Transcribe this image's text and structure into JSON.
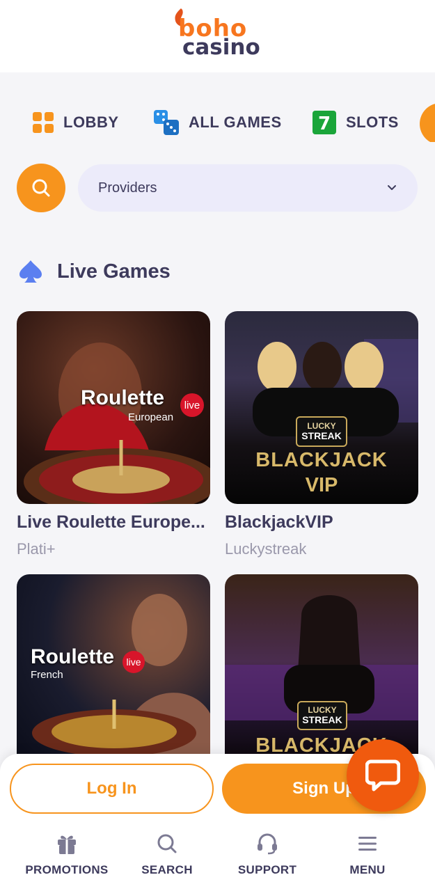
{
  "header": {
    "logo_top": "boho",
    "logo_bottom": "casino"
  },
  "nav": {
    "items": [
      {
        "label": "LOBBY",
        "icon": "lobby-grid-icon"
      },
      {
        "label": "ALL GAMES",
        "icon": "dice-icon"
      },
      {
        "label": "SLOTS",
        "icon": "slots-seven-icon"
      }
    ]
  },
  "filters": {
    "search_icon": "search-icon",
    "providers_label": "Providers"
  },
  "section": {
    "title": "Live Games",
    "icon": "spade-icon"
  },
  "games": [
    {
      "title": "Live Roulette Europe...",
      "provider": "Plati+",
      "art_title": "Roulette",
      "art_sub": "European",
      "art_badge": "live"
    },
    {
      "title": "BlackjackVIP",
      "provider": "Luckystreak",
      "art_badge_top": "LUCKY",
      "art_badge_bottom": "STREAK",
      "art_title": "BLACKJACK",
      "art_sub": "VIP"
    },
    {
      "art_title": "Roulette",
      "art_sub": "French",
      "art_badge": "live"
    },
    {
      "art_badge_top": "LUCKY",
      "art_badge_bottom": "STREAK",
      "art_title": "BLACKJACK"
    }
  ],
  "actions": {
    "login": "Log In",
    "signup": "Sign Up"
  },
  "tabbar": [
    {
      "label": "PROMOTIONS",
      "icon": "gift-icon"
    },
    {
      "label": "SEARCH",
      "icon": "search-icon"
    },
    {
      "label": "SUPPORT",
      "icon": "headset-icon"
    },
    {
      "label": "MENU",
      "icon": "hamburger-icon"
    }
  ],
  "colors": {
    "accent": "#f7941d",
    "chat": "#f05a0e",
    "text": "#3d3a5c",
    "muted": "#9a98ab",
    "providers_bg": "#ecebfa"
  }
}
